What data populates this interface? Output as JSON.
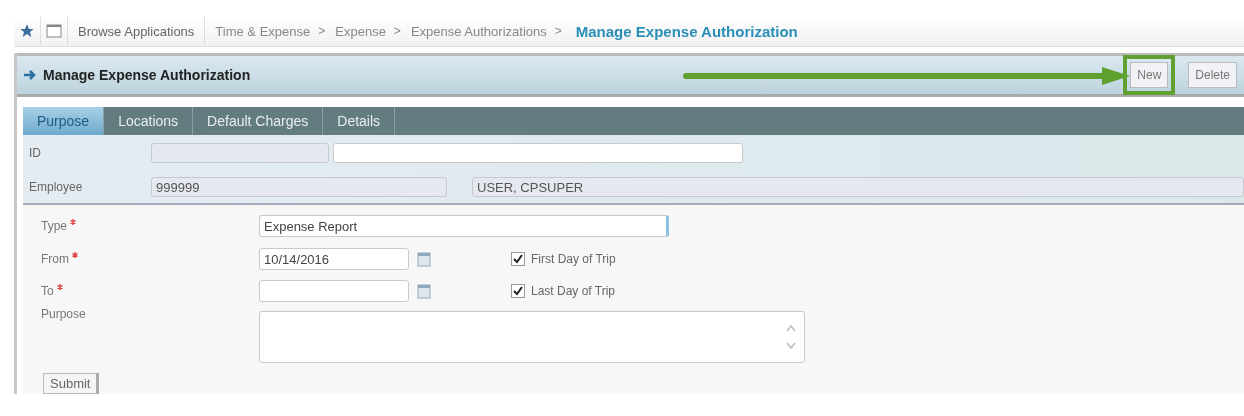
{
  "breadcrumbs": {
    "home_label": "Browse Applications",
    "path": [
      "Time & Expense",
      "Expense",
      "Expense Authorizations"
    ],
    "separator": ">",
    "current": "Manage Expense Authorization"
  },
  "panel": {
    "title": "Manage Expense Authorization"
  },
  "toolbar": [
    {
      "label": "New",
      "highlighted": true
    },
    {
      "label": "Delete",
      "highlighted": false
    }
  ],
  "tabs": [
    {
      "label": "Purpose",
      "selected": true
    },
    {
      "label": "Locations",
      "selected": false
    },
    {
      "label": "Default Charges",
      "selected": false
    },
    {
      "label": "Details",
      "selected": false
    }
  ],
  "header_fields": [
    {
      "label": "ID"
    },
    {
      "label": "Employee",
      "code": "999999",
      "name": "USER, CPSUPER"
    }
  ],
  "form_fields": [
    {
      "kind": "text",
      "label": "Type",
      "required": true,
      "value": "Expense Report"
    },
    {
      "kind": "date",
      "label": "From",
      "required": true,
      "value": "10/14/2016",
      "checkbox": {
        "label": "First Day of Trip",
        "checked": true
      }
    },
    {
      "kind": "date",
      "label": "To",
      "required": true,
      "checkbox": {
        "label": "Last Day of Trip",
        "checked": true
      }
    },
    {
      "kind": "textarea",
      "label": "Purpose",
      "required": false
    }
  ],
  "submit_button": "Submit"
}
